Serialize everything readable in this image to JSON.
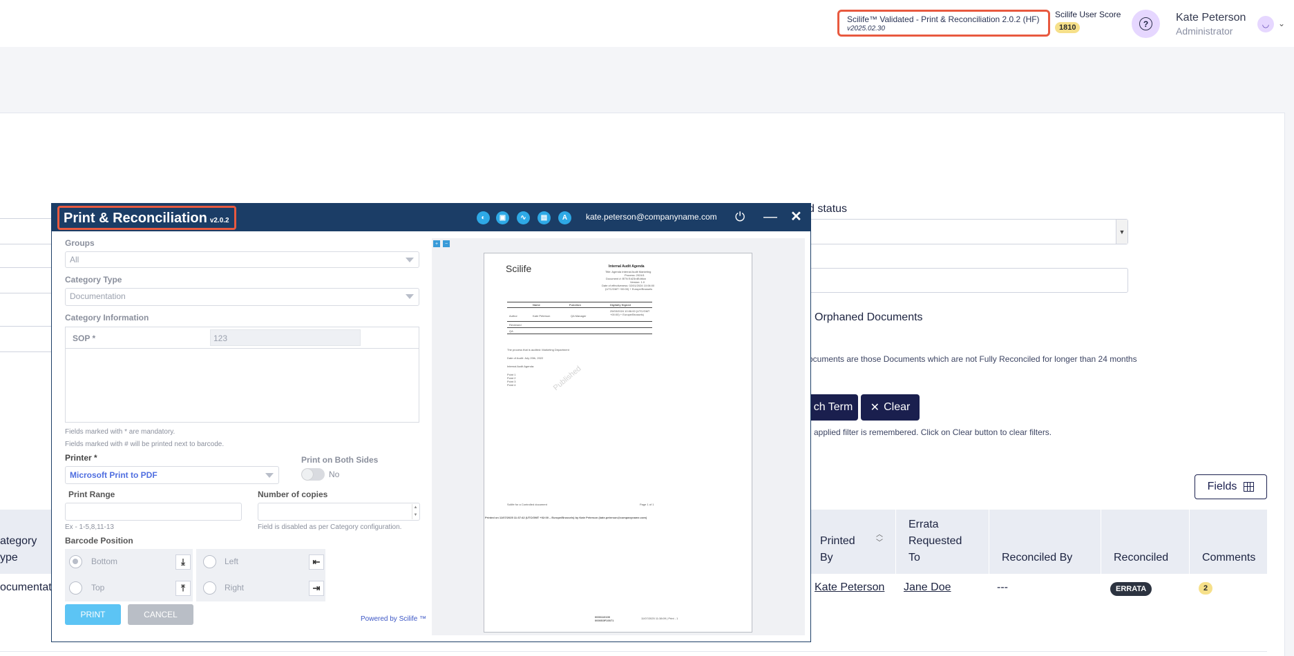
{
  "header": {
    "version_title": "Scilife™ Validated - Print & Reconciliation 2.0.2 (HF)",
    "version_sub": "v2025.02.30",
    "score_label": "Scilife User Score",
    "score_value": "1810",
    "help_symbol": "?",
    "user_name": "Kate Peterson",
    "user_role": "Administrator"
  },
  "background": {
    "status_label": "d status",
    "orphaned_label": "Orphaned Documents",
    "orphaned_note": "ocuments are those Documents which are not Fully Reconciled for longer than 24 months",
    "search_term_btn": "ch Term",
    "clear_btn": "Clear",
    "filter_note": "applied filter is remembered. Click on Clear button to clear filters.",
    "fields_btn": "Fields",
    "table": {
      "headers": [
        "ategory\nype",
        "Printed\nBy",
        "Errata\nRequested\nTo",
        "Reconciled By",
        "Reconciled",
        "Comments"
      ],
      "row": {
        "category": "ocumentati",
        "printed_by": "Kate Peterson",
        "errata_to": "Jane Doe",
        "reconciled_by": "---",
        "reconciled": "ERRATA",
        "comments": "2"
      }
    }
  },
  "modal": {
    "title": "Print & Reconciliation",
    "version": "v2.0.2",
    "email": "kate.peterson@companyname.com",
    "groups_label": "Groups",
    "groups_value": "All",
    "category_type_label": "Category Type",
    "category_type_value": "Documentation",
    "category_info_label": "Category Information",
    "sop_label": "SOP *",
    "sop_value": "123",
    "hint_mandatory": "Fields marked with * are mandatory.",
    "hint_barcode": "Fields marked with # will be printed next to barcode.",
    "printer_label": "Printer *",
    "printer_value": "Microsoft Print to PDF",
    "both_sides_label": "Print on Both Sides",
    "both_sides_value": "No",
    "print_range_label": "Print Range",
    "print_range_hint": "Ex - 1-5,8,11-13",
    "copies_label": "Number of copies",
    "copies_hint": "Field is disabled as per  Category configuration.",
    "barcode_label": "Barcode Position",
    "barcode_options": [
      "Bottom",
      "Top",
      "Left",
      "Right"
    ],
    "barcode_selected": "Bottom",
    "print_btn": "PRINT",
    "cancel_btn": "CANCEL",
    "powered": "Powered by Scilife ™"
  },
  "preview": {
    "logo": "Scilife",
    "doc_title": "Internal Audit Agenda",
    "doc_meta": [
      "Title: Agenda Internal Audit Marketing",
      "Process: 2024/1",
      "Document #: BTN Ed23rdEdition",
      "Version: 1.0",
      "Date of effectiveness: 02/01/2024 10:06:00",
      "(UTC/GMT +00:00) + Europe/Brussels"
    ],
    "sign_headers": [
      "Name",
      "Function",
      "Digitally Signed"
    ],
    "sign_rows": [
      [
        "Author",
        "Kate Peterson",
        "QA Manager",
        "25/03/2024 10:06:00 (UTC/GMT +00:00) + Europe/Brussels)"
      ],
      [
        "Reviewed",
        "",
        "",
        ""
      ],
      [
        "QA",
        "",
        "",
        ""
      ]
    ],
    "body_lines": [
      "The process that is audited: Marketing Department",
      "Date of Audit: July 20th, 2022",
      "Internal Audit Agenda:"
    ],
    "points": [
      "Point 1",
      "Point 2",
      "Point 3",
      "Point 4"
    ],
    "watermark": "Published",
    "footer_left": "Scilife for a Controlled document",
    "footer_right": "Page 1 of 1",
    "printed_on": "Printed on 11/07/2025 11:37:42 (UTC/GMT +02:00 – Europe/Brussels) by Kate Peterson (kate.peterson@companyname.com)",
    "barcode_text": "0000110100 0000S0F10071",
    "barcode_stamp": "11/07/2025 11:38:09 | Print - 1"
  }
}
